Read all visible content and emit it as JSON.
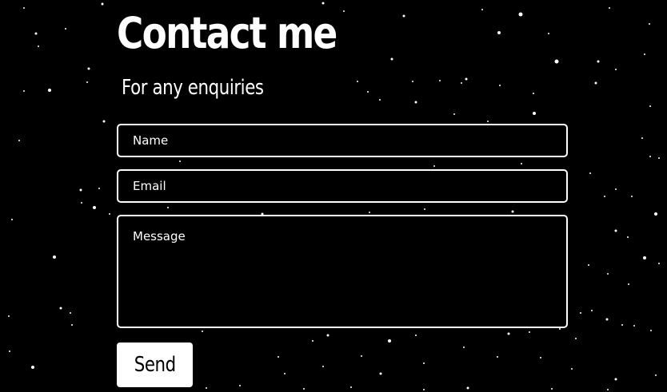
{
  "header": {
    "title": "Contact me",
    "subtitle": "For any enquiries"
  },
  "form": {
    "name_placeholder": "Name",
    "email_placeholder": "Email",
    "message_placeholder": "Message",
    "send_label": "Send"
  },
  "colors": {
    "background": "#000000",
    "foreground": "#ffffff"
  }
}
